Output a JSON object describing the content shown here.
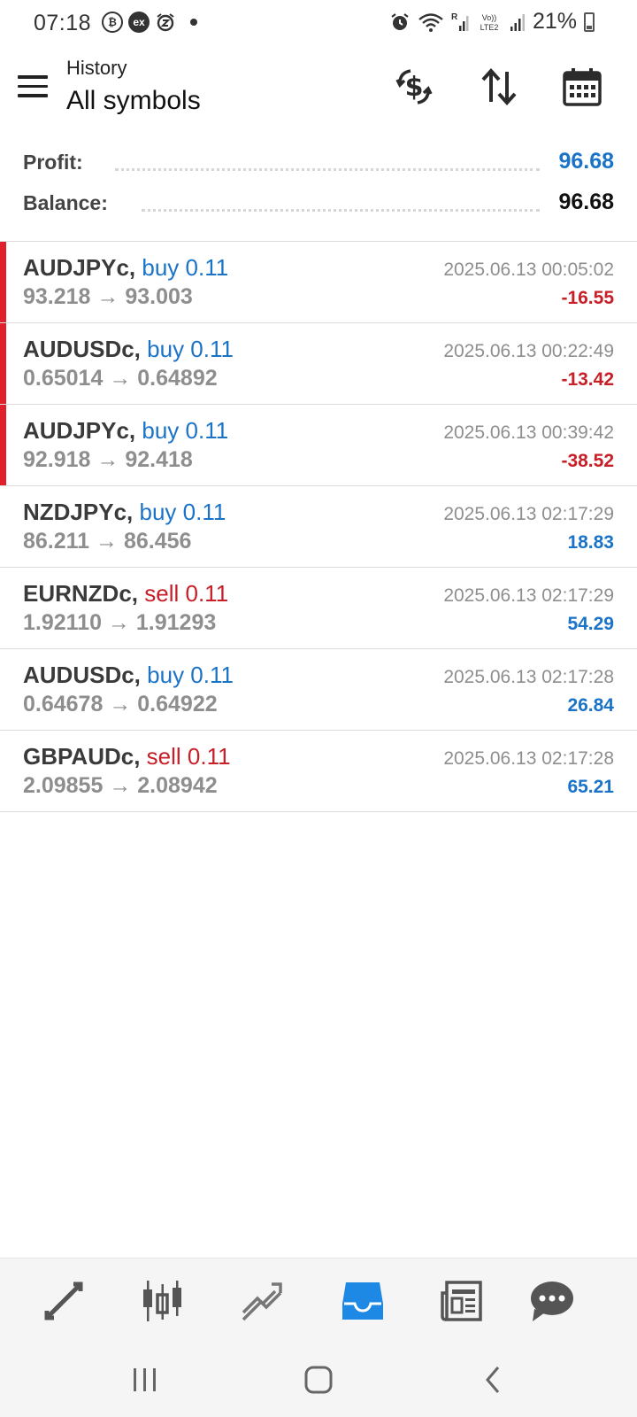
{
  "status_bar": {
    "time": "07:18",
    "left_icons": [
      "bitcoin-icon",
      "exness-icon",
      "alarm-snooze-icon",
      "dot-icon"
    ],
    "right_icons": [
      "alarm-icon",
      "wifi-icon",
      "signal-icon",
      "volte-icon",
      "signal-icon"
    ],
    "battery": "21%",
    "exness_label": "ex",
    "bitcoin_label": "₿",
    "volte_label": "Vo)) LTE2"
  },
  "header": {
    "subtitle": "History",
    "title": "All symbols",
    "icons": [
      "currency-exchange-icon",
      "sort-icon",
      "calendar-icon"
    ]
  },
  "summary": {
    "profit_label": "Profit:",
    "profit_value": "96.68",
    "balance_label": "Balance:",
    "balance_value": "96.68"
  },
  "colors": {
    "buy": "#1a73c7",
    "sell": "#c81e28",
    "loss": "#c81e28",
    "gain": "#1a73c7",
    "loss_bar": "#e0202a",
    "active_tab": "#1e88e5"
  },
  "trades": [
    {
      "symbol": "AUDJPYc,",
      "side": "buy 0.11",
      "side_type": "buy",
      "prices": "93.218 → 93.003",
      "time": "2025.06.13 00:05:02",
      "profit": "-16.55",
      "loss": true
    },
    {
      "symbol": "AUDUSDc,",
      "side": "buy 0.11",
      "side_type": "buy",
      "prices": "0.65014 → 0.64892",
      "time": "2025.06.13 00:22:49",
      "profit": "-13.42",
      "loss": true
    },
    {
      "symbol": "AUDJPYc,",
      "side": "buy 0.11",
      "side_type": "buy",
      "prices": "92.918 → 92.418",
      "time": "2025.06.13 00:39:42",
      "profit": "-38.52",
      "loss": true
    },
    {
      "symbol": "NZDJPYc,",
      "side": "buy 0.11",
      "side_type": "buy",
      "prices": "86.211 → 86.456",
      "time": "2025.06.13 02:17:29",
      "profit": "18.83",
      "loss": false
    },
    {
      "symbol": "EURNZDc,",
      "side": "sell 0.11",
      "side_type": "sell",
      "prices": "1.92110 → 1.91293",
      "time": "2025.06.13 02:17:29",
      "profit": "54.29",
      "loss": false
    },
    {
      "symbol": "AUDUSDc,",
      "side": "buy 0.11",
      "side_type": "buy",
      "prices": "0.64678 → 0.64922",
      "time": "2025.06.13 02:17:28",
      "profit": "26.84",
      "loss": false
    },
    {
      "symbol": "GBPAUDc,",
      "side": "sell 0.11",
      "side_type": "sell",
      "prices": "2.09855 → 2.08942",
      "time": "2025.06.13 02:17:28",
      "profit": "65.21",
      "loss": false
    }
  ],
  "tabbar": {
    "tabs": [
      {
        "icon": "quotes-icon",
        "active": false
      },
      {
        "icon": "chart-candles-icon",
        "active": false
      },
      {
        "icon": "trade-icon",
        "active": false
      },
      {
        "icon": "history-inbox-icon",
        "active": true
      },
      {
        "icon": "news-icon",
        "active": false
      },
      {
        "icon": "chat-icon",
        "active": false
      }
    ]
  },
  "navbar": {
    "icons": [
      "recent-apps-icon",
      "home-icon",
      "back-icon"
    ]
  }
}
